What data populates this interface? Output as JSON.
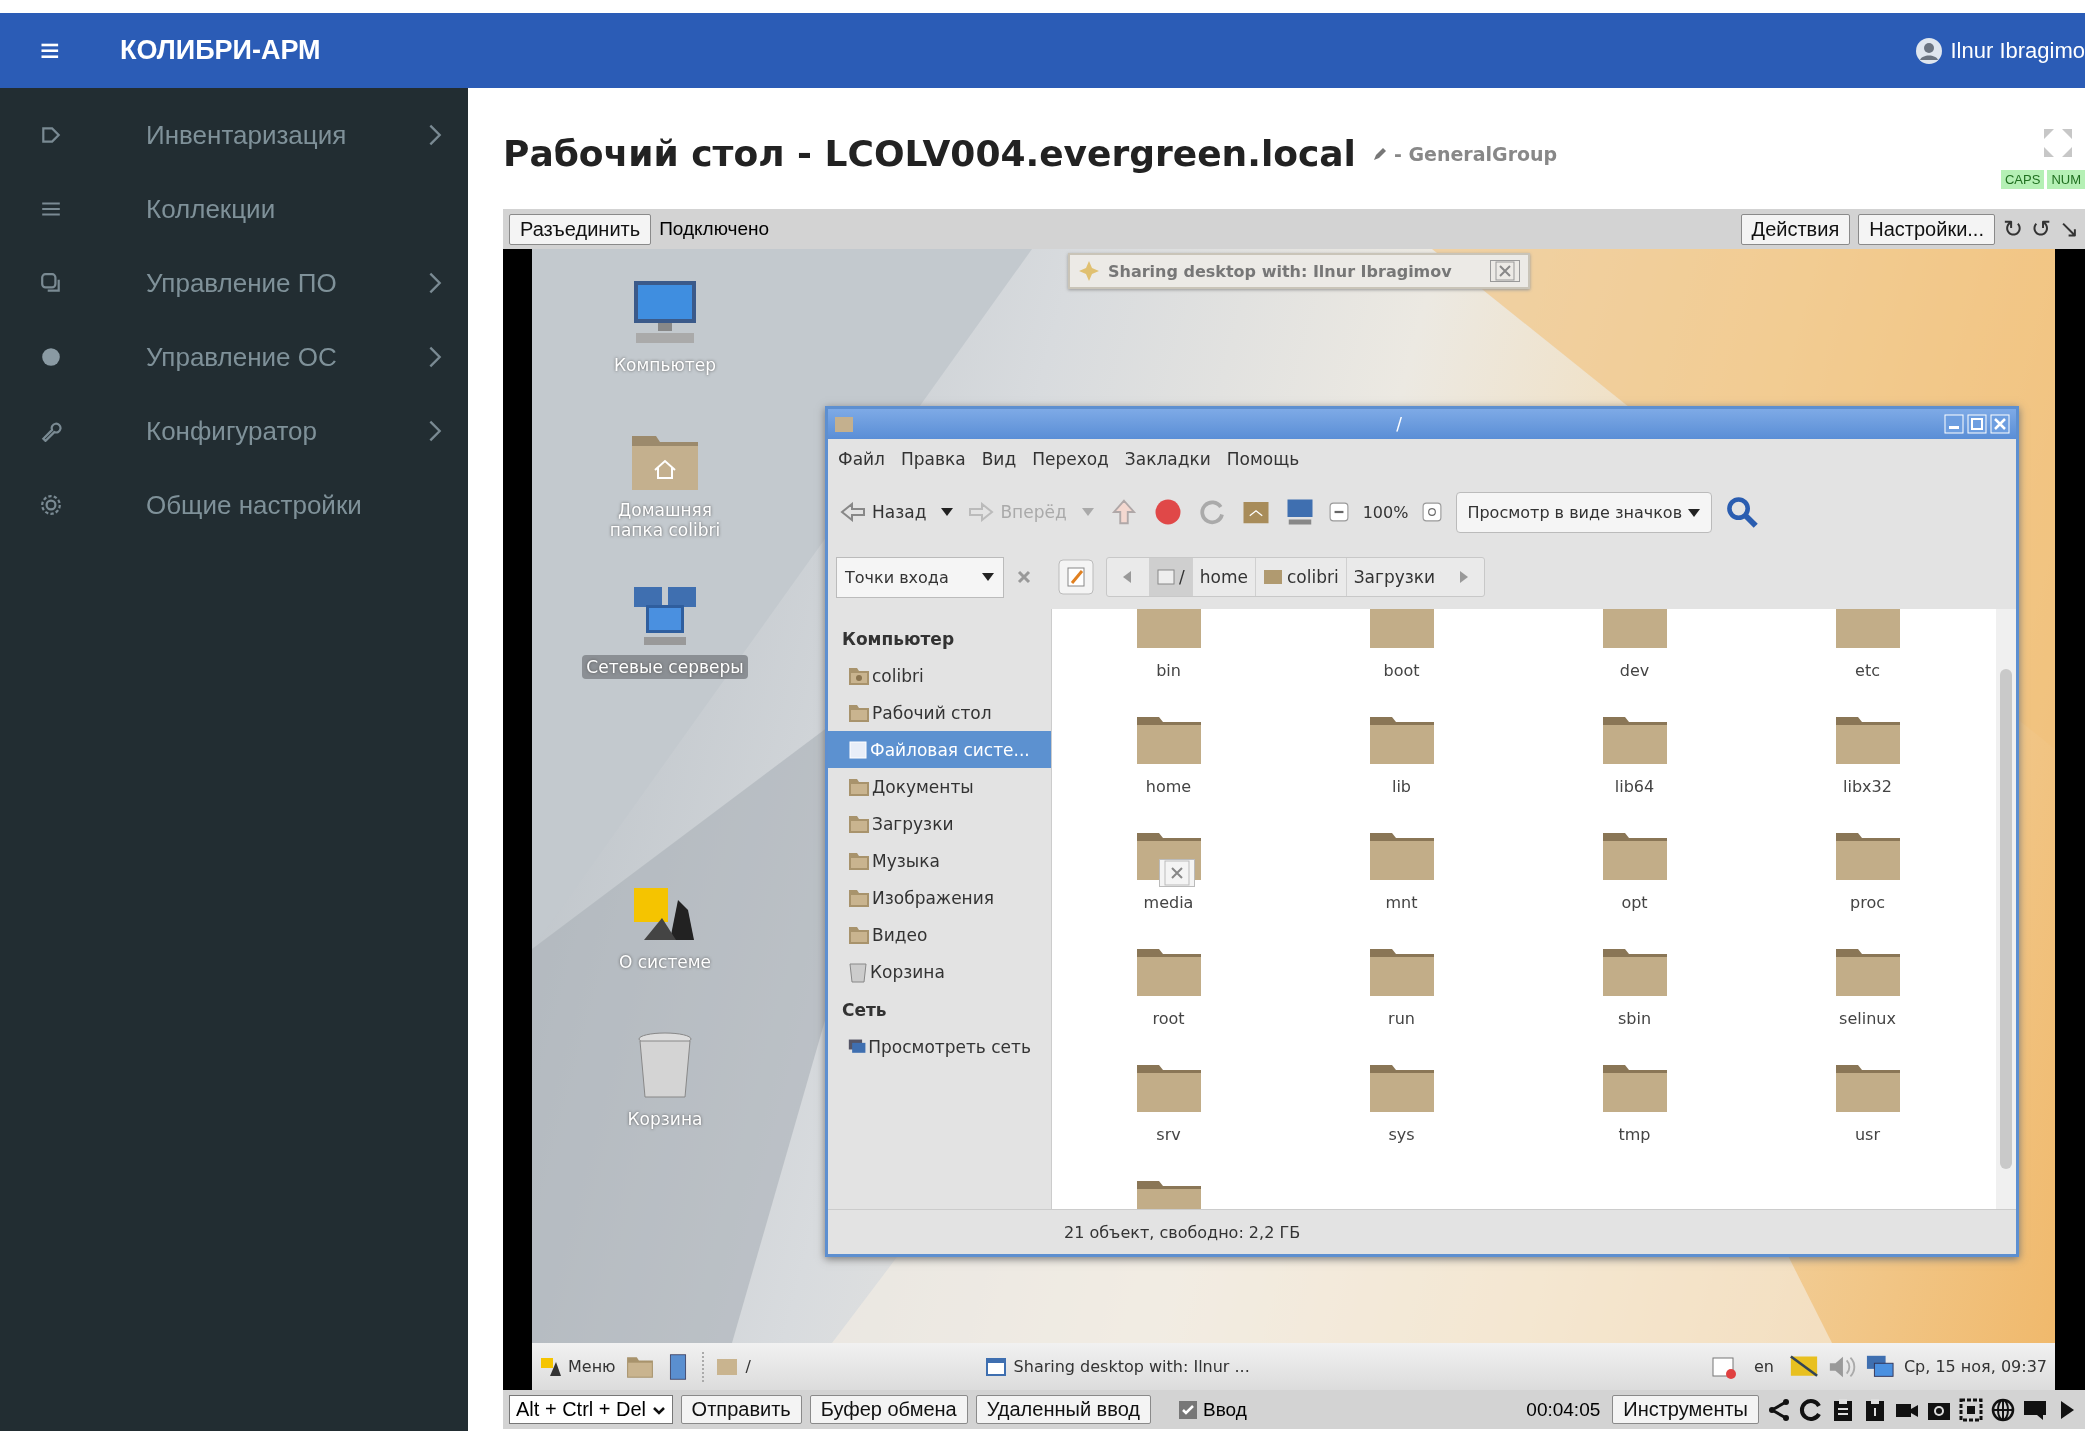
{
  "header": {
    "menu_glyph": "≡",
    "brand": "КОЛИБРИ-АРМ",
    "user": "Ilnur Ibragimo"
  },
  "sidebar": {
    "items": [
      {
        "label": "Инвентаризация",
        "has_submenu": true
      },
      {
        "label": "Коллекции",
        "has_submenu": false
      },
      {
        "label": "Управление ПО",
        "has_submenu": true
      },
      {
        "label": "Управление ОС",
        "has_submenu": true
      },
      {
        "label": "Конфигуратор",
        "has_submenu": true
      },
      {
        "label": "Общие настройки",
        "has_submenu": false
      }
    ]
  },
  "page": {
    "title": "Рабочий стол - LCOLV004.evergreen.local",
    "group": "- GeneralGroup",
    "indicators": [
      "CAPS",
      "NUM"
    ]
  },
  "session_toolbar": {
    "disconnect": "Разъединить",
    "status": "Подключено",
    "actions": "Действия",
    "settings": "Настройки...",
    "glyphs": [
      "↻",
      "↺",
      "↘"
    ]
  },
  "remote_desktop": {
    "sharing_notice": "Sharing desktop with: Ilnur Ibragimov",
    "desktop_icons": [
      {
        "kind": "computer",
        "label": "Компьютер",
        "selected": false
      },
      {
        "kind": "home",
        "label": "Домашняя папка colibri",
        "selected": false
      },
      {
        "kind": "network",
        "label": "Сетевые серверы",
        "selected": true
      },
      {
        "kind": "logo",
        "label": "О системе",
        "selected": false
      },
      {
        "kind": "trash",
        "label": "Корзина",
        "selected": false
      }
    ],
    "file_manager": {
      "title": "/",
      "menu": [
        "Файл",
        "Правка",
        "Вид",
        "Переход",
        "Закладки",
        "Помощь"
      ],
      "back": {
        "label": "Назад",
        "disabled": false
      },
      "forward": {
        "label": "Вперёд",
        "disabled": true
      },
      "zoom": "100%",
      "view_mode": "Просмотр в виде значков",
      "places_select": "Точки входа",
      "breadcrumb": [
        {
          "kind": "drive",
          "label": "/",
          "selected": true
        },
        {
          "kind": "plain",
          "label": "home",
          "selected": false
        },
        {
          "kind": "home",
          "label": "colibri",
          "selected": false
        },
        {
          "kind": "plain",
          "label": "Загрузки",
          "selected": false
        }
      ],
      "side_pane": [
        {
          "title": "Компьютер",
          "items": [
            {
              "kind": "home",
              "label": "colibri",
              "selected": false
            },
            {
              "kind": "folder",
              "label": "Рабочий стол",
              "selected": false
            },
            {
              "kind": "drive",
              "label": "Файловая систе...",
              "selected": true
            },
            {
              "kind": "folder",
              "label": "Документы",
              "selected": false
            },
            {
              "kind": "folder",
              "label": "Загрузки",
              "selected": false
            },
            {
              "kind": "folder",
              "label": "Музыка",
              "selected": false
            },
            {
              "kind": "folder",
              "label": "Изображения",
              "selected": false
            },
            {
              "kind": "folder",
              "label": "Видео",
              "selected": false
            },
            {
              "kind": "trash",
              "label": "Корзина",
              "selected": false
            }
          ]
        },
        {
          "title": "Сеть",
          "items": [
            {
              "kind": "network",
              "label": "Просмотреть сеть",
              "selected": false
            }
          ]
        }
      ],
      "folders": [
        "bin",
        "boot",
        "dev",
        "etc",
        "home",
        "lib",
        "lib64",
        "libx32",
        "media",
        "mnt",
        "opt",
        "proc",
        "root",
        "run",
        "sbin",
        "selinux",
        "srv",
        "sys",
        "tmp",
        "usr"
      ],
      "status": "21 объект, свободно: 2,2 ГБ"
    },
    "taskbar": {
      "menu": "Меню",
      "tasks": [
        "/",
        "Sharing desktop with: Ilnur ..."
      ],
      "layout": "en",
      "clock": "Ср, 15 ноя, 09:37"
    }
  },
  "bottom_bar": {
    "key_combo": "Alt + Ctrl + Del",
    "buttons": [
      "Отправить",
      "Буфер обмена",
      "Удаленный ввод"
    ],
    "input_toggle": {
      "label": "Ввод",
      "checked": true
    },
    "timer": "00:04:05",
    "tools": "Инструменты"
  }
}
